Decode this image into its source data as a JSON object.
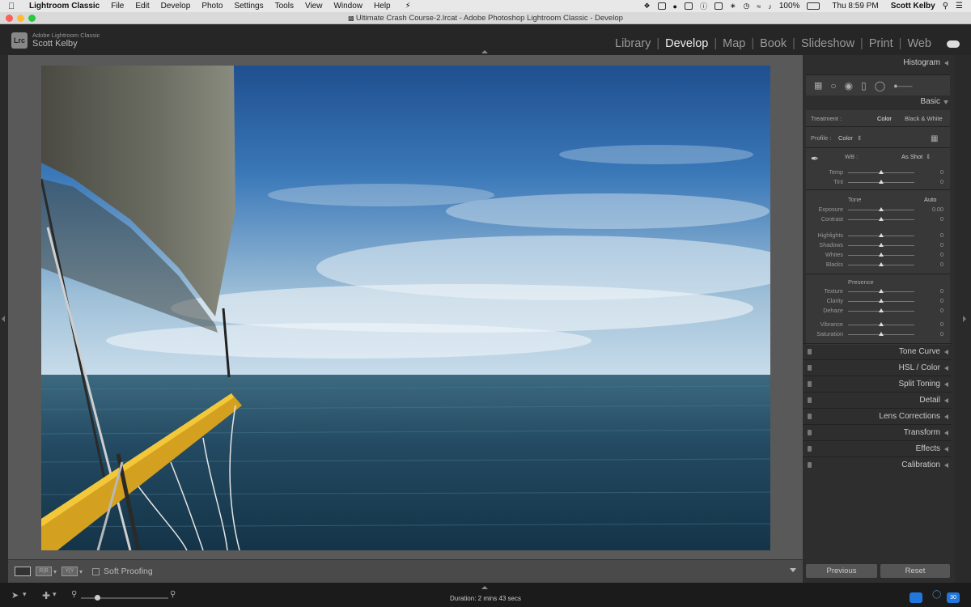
{
  "menubar": {
    "apple": "",
    "app": "Lightroom Classic",
    "items": [
      "File",
      "Edit",
      "Develop",
      "Photo",
      "Settings",
      "Tools",
      "View",
      "Window",
      "Help"
    ],
    "battery": "100%",
    "clock": "Thu 8:59 PM",
    "user": "Scott Kelby"
  },
  "window": {
    "title": "Ultimate Crash Course-2.lrcat - Adobe Photoshop Lightroom Classic - Develop"
  },
  "identity": {
    "logo": "Lrc",
    "product": "Adobe Lightroom Classic",
    "user": "Scott Kelby"
  },
  "modules": {
    "items": [
      "Library",
      "Develop",
      "Map",
      "Book",
      "Slideshow",
      "Print",
      "Web"
    ],
    "active": "Develop"
  },
  "toolbar": {
    "soft_proofing": "Soft Proofing",
    "rb": "R|B",
    "yy": "Y|Y"
  },
  "panels": {
    "histogram": "Histogram",
    "basic": "Basic",
    "treatment_label": "Treatment :",
    "treatment_color": "Color",
    "treatment_bw": "Black & White",
    "profile_label": "Profile :",
    "profile_value": "Color",
    "wb_label": "WB :",
    "wb_value": "As Shot",
    "temp": {
      "label": "Temp",
      "value": "0",
      "pos": 0.5
    },
    "tint": {
      "label": "Tint",
      "value": "0",
      "pos": 0.5
    },
    "tone_label": "Tone",
    "auto_label": "Auto",
    "tone_sliders": [
      {
        "label": "Exposure",
        "value": "0.00",
        "pos": 0.5
      },
      {
        "label": "Contrast",
        "value": "0",
        "pos": 0.5
      },
      {
        "label": "Highlights",
        "value": "0",
        "pos": 0.5
      },
      {
        "label": "Shadows",
        "value": "0",
        "pos": 0.5
      },
      {
        "label": "Whites",
        "value": "0",
        "pos": 0.5
      },
      {
        "label": "Blacks",
        "value": "0",
        "pos": 0.5
      }
    ],
    "presence_label": "Presence",
    "presence_sliders": [
      {
        "label": "Texture",
        "value": "0",
        "pos": 0.5
      },
      {
        "label": "Clarity",
        "value": "0",
        "pos": 0.5
      },
      {
        "label": "Dehaze",
        "value": "0",
        "pos": 0.5
      },
      {
        "label": "Vibrance",
        "value": "0",
        "pos": 0.5
      },
      {
        "label": "Saturation",
        "value": "0",
        "pos": 0.5
      }
    ],
    "collapsed": [
      "Tone Curve",
      "HSL / Color",
      "Split Toning",
      "Detail",
      "Lens Corrections",
      "Transform",
      "Effects",
      "Calibration"
    ]
  },
  "buttons": {
    "previous": "Previous",
    "reset": "Reset"
  },
  "filmstrip": {
    "duration": "Duration: 2 mins 43 secs",
    "tag1": "",
    "tag2": "30"
  }
}
